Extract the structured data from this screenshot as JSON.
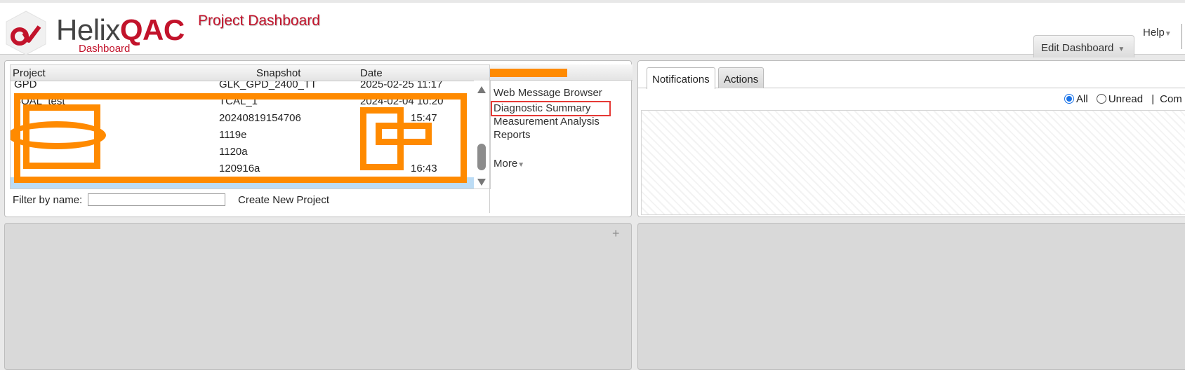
{
  "header": {
    "brand_helix": "Helix",
    "brand_qac": "QAC",
    "brand_sub": "Dashboard",
    "page_title": "Project Dashboard",
    "help_label": "Help",
    "edit_dashboard_label": "Edit Dashboard"
  },
  "projects": {
    "columns": [
      "Project",
      "Snapshot",
      "Date"
    ],
    "rows": [
      {
        "project": "GPD",
        "snapshot": "GLK_GPD_2400_TT",
        "date": "2025-02-25 11:17"
      },
      {
        "project": "SOAL_test",
        "snapshot": "TCAL_1",
        "date": "2024-02-04 10:20"
      },
      {
        "project": "",
        "snapshot": "20240819154706",
        "date": "15:47"
      },
      {
        "project": "",
        "snapshot": "1119e",
        "date": ""
      },
      {
        "project": "",
        "snapshot": "1120a",
        "date": ""
      },
      {
        "project": "",
        "snapshot": "120916a",
        "date": "16:43"
      },
      {
        "project": "",
        "snapshot": "",
        "date": ""
      }
    ],
    "filter_label": "Filter by name:",
    "filter_value": "",
    "create_label": "Create New Project"
  },
  "links": {
    "items": [
      "Web Message Browser",
      "Diagnostic Summary",
      "Measurement Analysis",
      "Reports"
    ],
    "more_label": "More"
  },
  "notifications": {
    "tabs": [
      "Notifications",
      "Actions"
    ],
    "filter_all": "All",
    "filter_unread": "Unread",
    "filter_separator": "|",
    "filter_more": "Com"
  },
  "icons": {
    "logo": "helix-logo-icon",
    "caret": "caret-down-icon",
    "scroll_up": "scroll-up-icon",
    "scroll_down": "scroll-down-icon",
    "add": "plus-icon"
  },
  "colors": {
    "brand_red": "#c2132b",
    "selected_row": "#bcdcf5",
    "redaction": "#ff8a00",
    "highlight_box": "#e53935"
  }
}
